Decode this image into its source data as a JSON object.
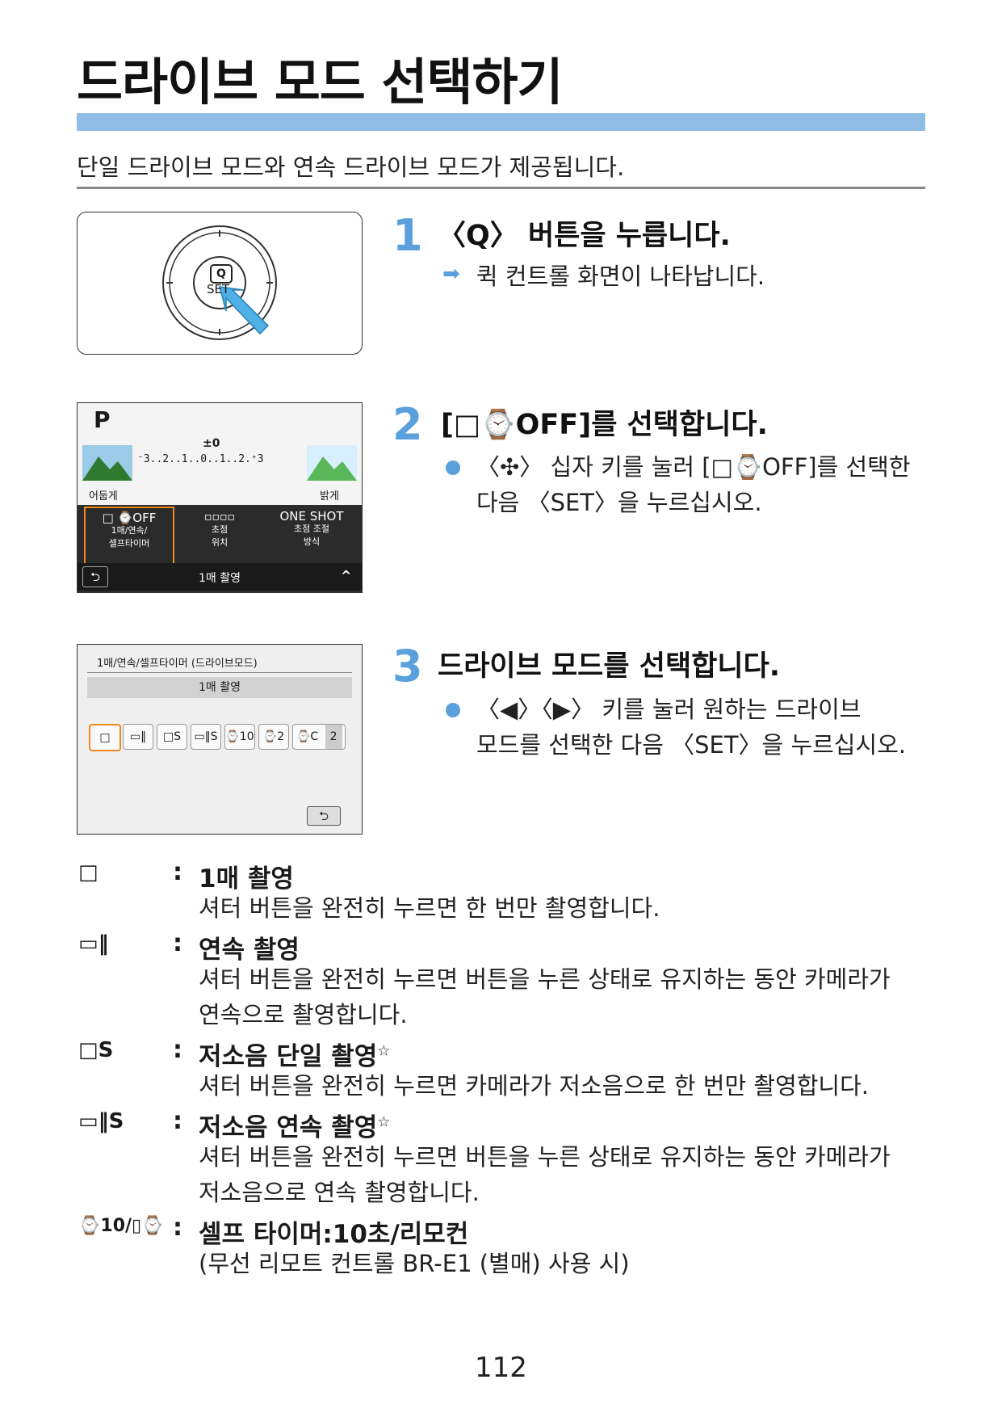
{
  "title": "드라이브 모드 선택하기",
  "intro": "단일 드라이브 모드와 연속 드라이브 모드가 제공됩니다.",
  "accent_color": "#8fbde6",
  "step_color": "#5aa0dd",
  "image1": {
    "button_q": "Q",
    "button_set": "SET"
  },
  "image2": {
    "mode": "P",
    "exposure_comp": "±0",
    "scale": "⁻3..2..1..0..1..2.⁺3",
    "dark_label": "어둡게",
    "bright_label": "밝게",
    "cells": [
      {
        "icon": "□ ⌚OFF",
        "label1": "1매/연속/",
        "label2": "셀프타이머"
      },
      {
        "icon": "▫▫▫▫",
        "label1": "초점",
        "label2": "위치"
      },
      {
        "icon": "ONE SHOT",
        "label1": "초점 조절",
        "label2": "방식"
      }
    ],
    "back_icon": "⮌",
    "bottom_label": "1매 촬영",
    "caret": "^"
  },
  "image3": {
    "header": "1매/연속/셀프타이머 (드라이브모드)",
    "selected_label": "1매 촬영",
    "modes": [
      "□",
      "▭‖",
      "□S",
      "▭‖S",
      "⌚10",
      "⌚2",
      "⌚C"
    ],
    "count": "2",
    "back_icon": "⮌"
  },
  "steps": [
    {
      "num": "1",
      "head": "〈Q〉 버튼을 누릅니다.",
      "lines": [
        "퀵 컨트롤 화면이 나타납니다."
      ]
    },
    {
      "num": "2",
      "head": "[□⌚OFF]를 선택합니다.",
      "lines": [
        "〈✣〉 십자 키를 눌러 [□⌚OFF]를 선택한",
        "다음 〈SET〉을 누르십시오."
      ]
    },
    {
      "num": "3",
      "head": "드라이브 모드를 선택합니다.",
      "lines": [
        "〈◀〉〈▶〉 키를 눌러 원하는 드라이브",
        "모드를 선택한 다음 〈SET〉을 누르십시오."
      ]
    }
  ],
  "drive_modes": [
    {
      "icon": "□",
      "colon": ":",
      "title": "1매 촬영",
      "star": "",
      "desc": [
        "셔터 버튼을 완전히 누르면 한 번만 촬영합니다."
      ]
    },
    {
      "icon": "▭‖",
      "colon": ":",
      "title": "연속 촬영",
      "star": "",
      "desc": [
        "셔터 버튼을 완전히 누르면 버튼을 누른 상태로 유지하는 동안 카메라가",
        "연속으로 촬영합니다."
      ]
    },
    {
      "icon": "□S",
      "colon": ":",
      "title": "저소음 단일 촬영",
      "star": "☆",
      "desc": [
        "셔터 버튼을 완전히 누르면 카메라가 저소음으로 한 번만 촬영합니다."
      ]
    },
    {
      "icon": "▭‖S",
      "colon": ":",
      "title": "저소음 연속 촬영",
      "star": "☆",
      "desc": [
        "셔터 버튼을 완전히 누르면 버튼을 누른 상태로 유지하는 동안 카메라가",
        "저소음으로 연속 촬영합니다."
      ]
    },
    {
      "icon": "⌚10/▯⌚",
      "colon": ":",
      "title": "셀프 타이머:10초/리모컨",
      "star": "",
      "desc": [
        "(무선 리모트 컨트롤 BR-E1 (별매) 사용 시)"
      ]
    }
  ],
  "page_number": "112"
}
